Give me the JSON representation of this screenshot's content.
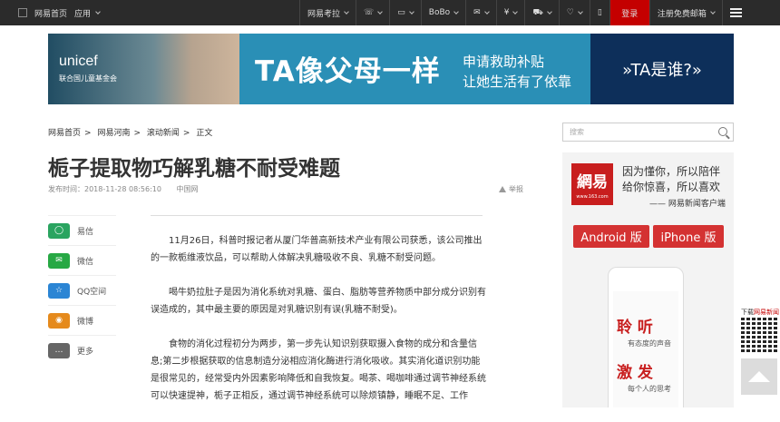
{
  "topbar": {
    "home": "网易首页",
    "apps": "应用",
    "exam": "网易考拉",
    "bobo": "BoBo",
    "login": "登录",
    "register": "注册免费邮箱"
  },
  "banner": {
    "brand": "unicef",
    "brand_sub": "联合国儿童基金会",
    "headline": "TA像父母一样",
    "sub1": "申请救助补贴",
    "sub2": "让她生活有了依靠",
    "who": "»TA是谁?»"
  },
  "breadcrumb": [
    "网易首页",
    ">",
    "网易河南",
    ">",
    "滚动新闻",
    ">",
    "正文"
  ],
  "article": {
    "title": "栀子提取物巧解乳糖不耐受难题",
    "publish_time": "发布时间：2018-11-28 08:56:10",
    "source": "中国网",
    "report": "举报",
    "paragraphs": [
      "11月26日，科普时报记者从厦门华普高新技术产业有限公司获悉，该公司推出的一款栀维液饮品，可以帮助人体解决乳糖吸收不良、乳糖不耐受问题。",
      "喝牛奶拉肚子是因为消化系统对乳糖、蛋白、脂肪等营养物质中部分成分识别有误造成的，其中最主要的原因是对乳糖识别有误(乳糖不耐受)。",
      "食物的消化过程初分为两步，第一步先认知识别获取摄入食物的成分和含量信息;第二步根据获取的信息制造分泌相应消化酶进行消化吸收。其实消化道识别功能是很常见的，经常受内外因素影响降低和自我恢复。喝茶、喝咖啡通过调节神经系统可以快速提神，栀子正相反，通过调节神经系统可以除烦镇静，睡眠不足、工作"
    ]
  },
  "share": [
    {
      "label": "易信",
      "color": "#2aa460",
      "glyph": "◯"
    },
    {
      "label": "微信",
      "color": "#27a844",
      "glyph": "✉"
    },
    {
      "label": "QQ空间",
      "color": "#2b85d4",
      "glyph": "☆"
    },
    {
      "label": "微博",
      "color": "#e58a1c",
      "glyph": "◉"
    },
    {
      "label": "更多",
      "color": "#666666",
      "glyph": "…"
    }
  ],
  "sidebar": {
    "search_placeholder": "搜索",
    "logo_text": "網易",
    "logo_url": "www.163.com",
    "slogan1": "因为懂你，所以陪伴",
    "slogan2": "给你惊喜，所以喜欢",
    "slogan3": "—— 网易新闻客户端",
    "android": "Android 版",
    "iphone": "iPhone 版",
    "phone_t1": "聆 听",
    "phone_t2": "有态度的声音",
    "phone_t3": "激 发",
    "phone_t4": "每个人的思考"
  },
  "qr": {
    "label_prefix": "下载",
    "label_red": "网易新闻"
  }
}
